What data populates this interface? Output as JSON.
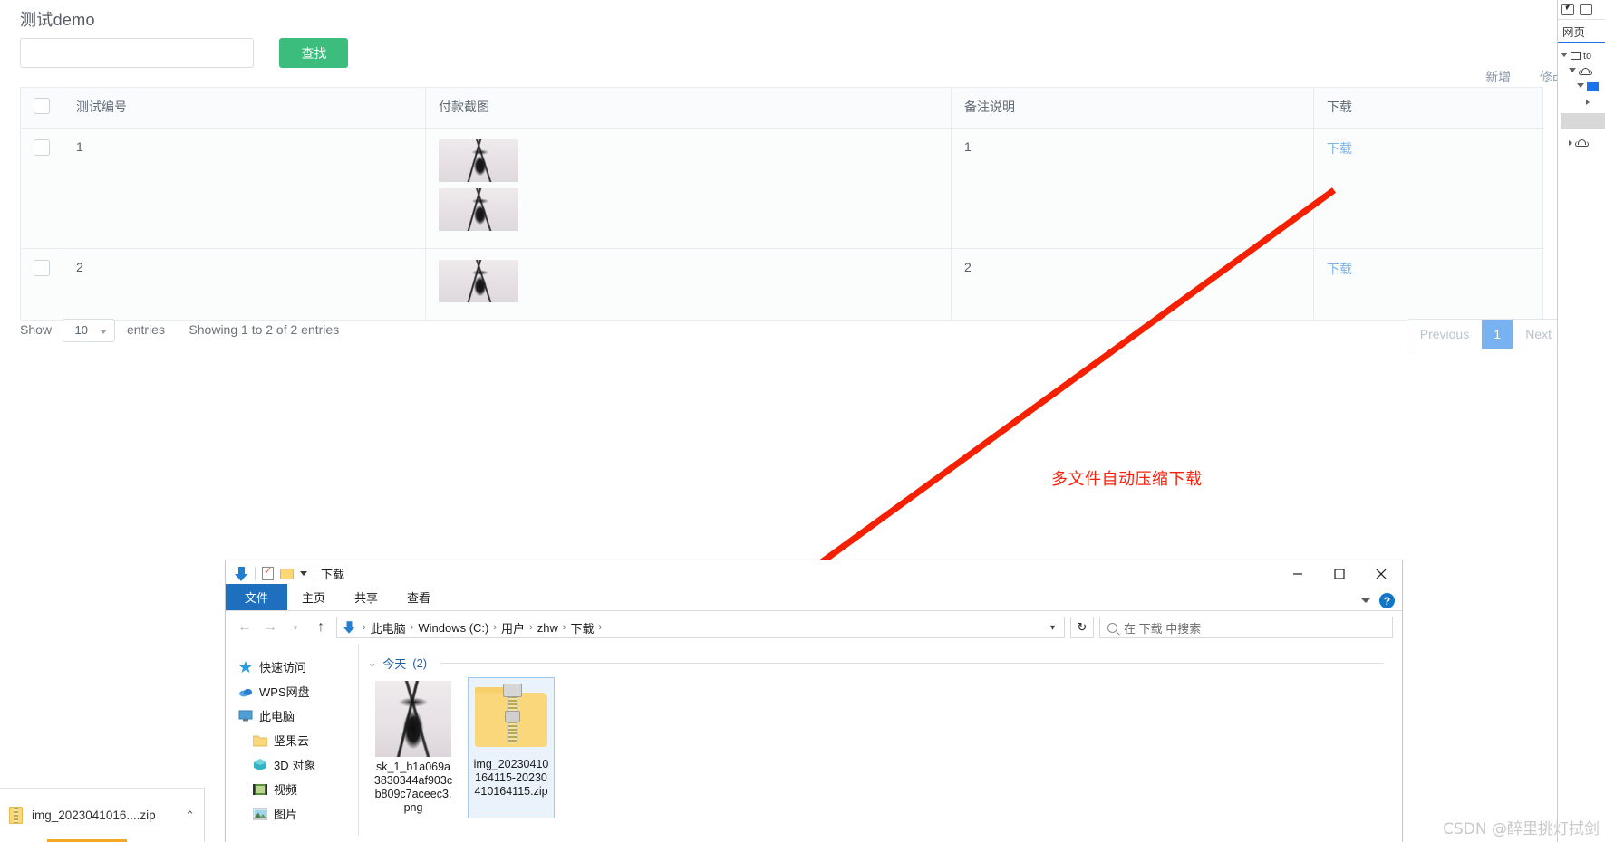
{
  "webapp": {
    "title": "测试demo",
    "search": {
      "value": "",
      "placeholder": ""
    },
    "search_button": "查找",
    "toolbar": {
      "add": "新增",
      "edit": "修改"
    },
    "table": {
      "columns": [
        "",
        "测试编号",
        "付款截图",
        "备注说明",
        "下载"
      ],
      "rows": [
        {
          "no": "1",
          "images": 2,
          "memo": "1",
          "download": "下载"
        },
        {
          "no": "2",
          "images": 1,
          "memo": "2",
          "download": "下载"
        }
      ]
    },
    "footer": {
      "show_label": "Show",
      "page_length": "10",
      "entries_label": "entries",
      "info": "Showing 1 to 2 of 2 entries"
    },
    "pagination": {
      "previous": "Previous",
      "pages": [
        "1"
      ],
      "next": "Next",
      "active": "1"
    }
  },
  "annotation": {
    "text": "多文件自动压缩下载",
    "color": "#fc1f08"
  },
  "explorer": {
    "window_title": "下载",
    "quick_access_icons": [
      "download-arrow-icon",
      "properties-icon",
      "new-folder-icon",
      "customize-caret-icon"
    ],
    "window_buttons": {
      "minimize": "—",
      "maximize": "☐",
      "close": "✕"
    },
    "ribbon_tabs": [
      "文件",
      "主页",
      "共享",
      "查看"
    ],
    "ribbon_active_tab": "文件",
    "help_label": "?",
    "address": {
      "crumbs": [
        "此电脑",
        "Windows (C:)",
        "用户",
        "zhw",
        "下载"
      ],
      "refresh_label": "↻"
    },
    "search": {
      "placeholder": "在 下载 中搜索",
      "value": ""
    },
    "nav": [
      {
        "label": "快速访问",
        "icon": "star-pin-icon",
        "child": false
      },
      {
        "label": "WPS网盘",
        "icon": "cloud-icon",
        "child": false
      },
      {
        "label": "此电脑",
        "icon": "computer-icon",
        "child": false
      },
      {
        "label": "坚果云",
        "icon": "folder-icon",
        "child": true
      },
      {
        "label": "3D 对象",
        "icon": "3d-objects-icon",
        "child": true
      },
      {
        "label": "视频",
        "icon": "videos-icon",
        "child": true
      },
      {
        "label": "图片",
        "icon": "pictures-icon",
        "child": true
      }
    ],
    "group": {
      "label": "今天",
      "count": "(2)"
    },
    "files": [
      {
        "name": "sk_1_b1a069a3830344af903cb809c7aceec3.png",
        "type": "image",
        "selected": false
      },
      {
        "name": "img_20230410164115-20230410164115.zip",
        "type": "zip",
        "selected": true
      }
    ]
  },
  "download_bar": {
    "file_name": "img_2023041016....zip",
    "caret": "⌃"
  },
  "devtools": {
    "tab": "网页",
    "nodes": [
      "to",
      "",
      "",
      ""
    ]
  },
  "watermark": "CSDN @醉里挑灯拭剑"
}
